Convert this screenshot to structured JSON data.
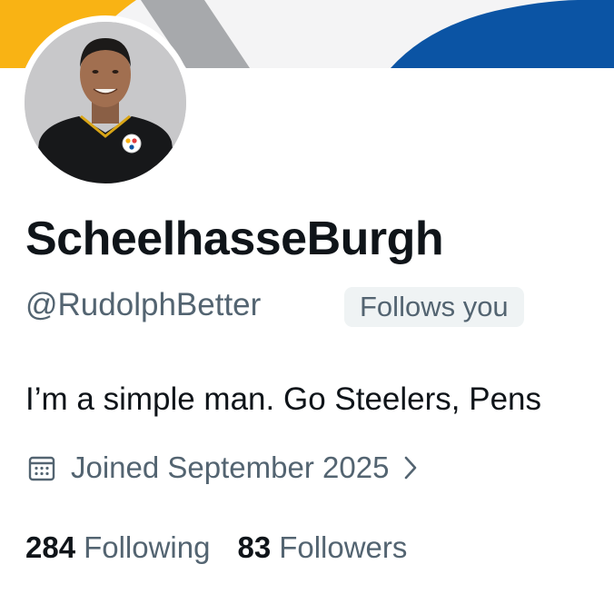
{
  "profile": {
    "display_name": "ScheelhasseBurgh",
    "handle": "@RudolphBetter",
    "follows_you": "Follows you",
    "bio": "I’m a simple man. Go Steelers, Pens",
    "joined": "Joined September 2025",
    "following_count": "284",
    "following_label": "Following",
    "followers_count": "83",
    "followers_label": "Followers"
  },
  "icons": {
    "joined": "calendar-icon",
    "joined_more": "chevron-right-icon"
  },
  "colors": {
    "banner_yellow": "#f9b314",
    "banner_blue": "#0b54a4",
    "banner_gray": "#a7a9ac",
    "secondary_text": "#536471",
    "badge_bg": "#eff3f4"
  }
}
